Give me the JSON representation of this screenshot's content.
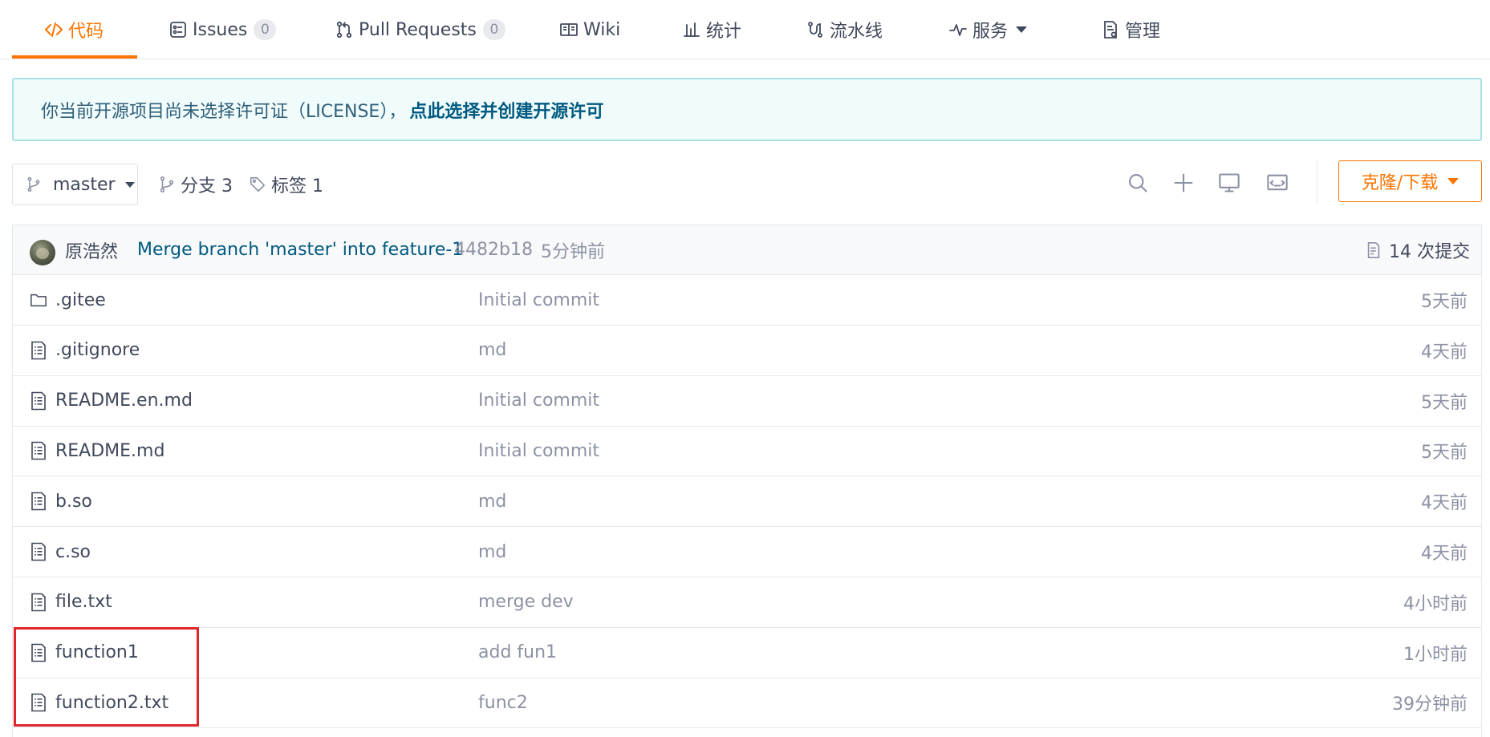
{
  "tabs": [
    {
      "label": "代码",
      "icon": "code-icon",
      "active": true
    },
    {
      "label": "Issues",
      "icon": "issues-icon",
      "badge": "0"
    },
    {
      "label": "Pull Requests",
      "icon": "pull-request-icon",
      "badge": "0"
    },
    {
      "label": "Wiki",
      "icon": "book-icon"
    },
    {
      "label": "统计",
      "icon": "bar-chart-icon"
    },
    {
      "label": "流水线",
      "icon": "pipeline-icon"
    },
    {
      "label": "服务",
      "icon": "pulse-icon",
      "dropdown": true
    },
    {
      "label": "管理",
      "icon": "settings-doc-icon"
    }
  ],
  "notice": {
    "text": "你当前开源项目尚未选择许可证（LICENSE），",
    "link": "点此选择并创建开源许可"
  },
  "branch": {
    "current": "master",
    "branches_label": "分支 3",
    "tags_label": "标签 1"
  },
  "toolbar": {
    "icons": [
      "search-icon",
      "plus-icon",
      "monitor-icon",
      "web-ide-icon"
    ],
    "clone_label": "克隆/下载"
  },
  "latest_commit": {
    "author": "原浩然",
    "message": "Merge branch 'master' into feature-1",
    "sha": "4482b18",
    "time": "5分钟前",
    "count_label": "14 次提交"
  },
  "files": [
    {
      "name": ".gitee",
      "type": "folder",
      "message": "Initial commit",
      "time": "5天前"
    },
    {
      "name": ".gitignore",
      "type": "file",
      "message": "md",
      "time": "4天前"
    },
    {
      "name": "README.en.md",
      "type": "file",
      "message": "Initial commit",
      "time": "5天前"
    },
    {
      "name": "README.md",
      "type": "file",
      "message": "Initial commit",
      "time": "5天前"
    },
    {
      "name": "b.so",
      "type": "file",
      "message": "md",
      "time": "4天前"
    },
    {
      "name": "c.so",
      "type": "file",
      "message": "md",
      "time": "4天前"
    },
    {
      "name": "file.txt",
      "type": "file",
      "message": "merge dev",
      "time": "4小时前"
    },
    {
      "name": "function1",
      "type": "file",
      "message": "add fun1",
      "time": "1小时前"
    },
    {
      "name": "function2.txt",
      "type": "file",
      "message": "func2",
      "time": "39分钟前"
    }
  ],
  "colors": {
    "accent": "#fe7300",
    "link": "#005980",
    "highlight": "#e0262a"
  }
}
